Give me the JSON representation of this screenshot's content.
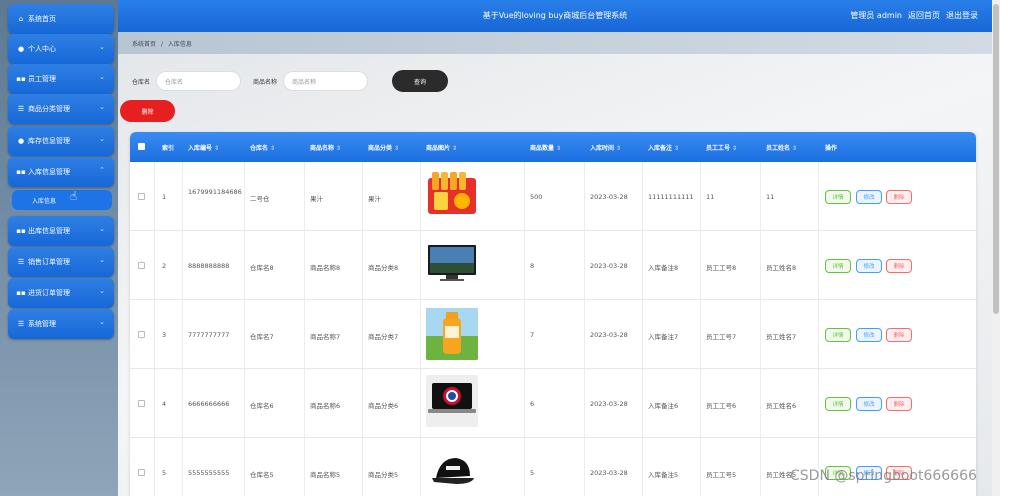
{
  "sidebar": {
    "items": [
      {
        "label": "系统首页",
        "icon": "home-icon",
        "chevron": false
      },
      {
        "label": "个人中心",
        "icon": "person-icon",
        "chevron": true
      },
      {
        "label": "员工管理",
        "icon": "grid-icon",
        "chevron": true
      },
      {
        "label": "商品分类管理",
        "icon": "list-icon",
        "chevron": true
      },
      {
        "label": "库存信息管理",
        "icon": "person-icon",
        "chevron": true
      },
      {
        "label": "入库信息管理",
        "icon": "grid-icon",
        "chevron": true
      },
      {
        "label": "出库信息管理",
        "icon": "grid-icon",
        "chevron": true
      },
      {
        "label": "销售订单管理",
        "icon": "list-icon",
        "chevron": true
      },
      {
        "label": "进货订单管理",
        "icon": "grid-icon",
        "chevron": true
      },
      {
        "label": "系统管理",
        "icon": "list-icon",
        "chevron": true
      }
    ],
    "active_sub": "入库信息"
  },
  "header": {
    "title": "基于Vue的loving buy商城后台管理系统",
    "role": "管理员 admin",
    "home_link": "返回首页",
    "logout": "退出登录"
  },
  "breadcrumb": {
    "root": "系统首页",
    "sep": "/",
    "current": "入库信息"
  },
  "search": {
    "warehouse_label": "仓库名",
    "warehouse_placeholder": "仓库名",
    "product_label": "商品名称",
    "product_placeholder": "商品名称",
    "search_button": "查询",
    "delete_button": "删除"
  },
  "table": {
    "columns": [
      "索引",
      "入库编号",
      "仓库名",
      "商品名称",
      "商品分类",
      "商品图片",
      "商品数量",
      "入库时间",
      "入库备注",
      "员工工号",
      "员工姓名",
      "操作"
    ],
    "rows": [
      {
        "index": "1",
        "code": "1679991184686",
        "warehouse": "二号仓",
        "name": "果汁",
        "category": "果汁",
        "image": "juice-pack",
        "qty": "500",
        "time": "2023-03-28",
        "note": "11111111111",
        "emp_no": "11",
        "emp_name": "11"
      },
      {
        "index": "2",
        "code": "8888888888",
        "warehouse": "仓库名8",
        "name": "商品名称8",
        "category": "商品分类8",
        "image": "monitor",
        "qty": "8",
        "time": "2023-03-28",
        "note": "入库备注8",
        "emp_no": "员工工号8",
        "emp_name": "员工姓名8"
      },
      {
        "index": "3",
        "code": "7777777777",
        "warehouse": "仓库名7",
        "name": "商品名称7",
        "category": "商品分类7",
        "image": "orange-juice",
        "qty": "7",
        "time": "2023-03-28",
        "note": "入库备注7",
        "emp_no": "员工工号7",
        "emp_name": "员工姓名7"
      },
      {
        "index": "4",
        "code": "6666666666",
        "warehouse": "仓库名6",
        "name": "商品名称6",
        "category": "商品分类6",
        "image": "laptop",
        "qty": "6",
        "time": "2023-03-28",
        "note": "入库备注6",
        "emp_no": "员工工号6",
        "emp_name": "员工姓名6"
      },
      {
        "index": "5",
        "code": "5555555555",
        "warehouse": "仓库名5",
        "name": "商品名称5",
        "category": "商品分类5",
        "image": "cap",
        "qty": "5",
        "time": "2023-03-28",
        "note": "入库备注5",
        "emp_no": "员工工号5",
        "emp_name": "员工姓名5"
      }
    ],
    "actions": {
      "detail": "详情",
      "edit": "修改",
      "delete": "删除"
    }
  },
  "watermark": "CSDN @springboot666666"
}
